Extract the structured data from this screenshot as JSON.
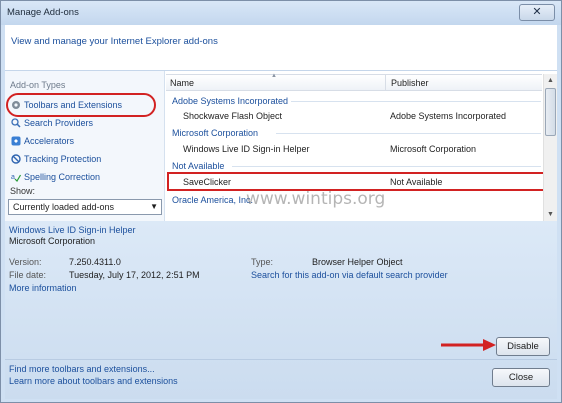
{
  "window": {
    "title": "Manage Add-ons",
    "close_glyph": "✕"
  },
  "header": {
    "text": "View and manage your Internet Explorer add-ons"
  },
  "left_pane": {
    "label": "Add-on Types",
    "items": [
      {
        "label": "Toolbars and Extensions",
        "icon": "gear-icon",
        "selected": true
      },
      {
        "label": "Search Providers",
        "icon": "search-icon",
        "selected": false
      },
      {
        "label": "Accelerators",
        "icon": "accelerator-icon",
        "selected": false
      },
      {
        "label": "Tracking Protection",
        "icon": "block-icon",
        "selected": false
      },
      {
        "label": "Spelling Correction",
        "icon": "spell-check-icon",
        "selected": false
      }
    ],
    "show_label": "Show:",
    "show_value": "Currently loaded add-ons"
  },
  "list": {
    "columns": {
      "name": "Name",
      "publisher": "Publisher"
    },
    "groups": [
      {
        "name": "Adobe Systems Incorporated",
        "rows": [
          {
            "name": "Shockwave Flash Object",
            "publisher": "Adobe Systems Incorporated"
          }
        ]
      },
      {
        "name": "Microsoft Corporation",
        "rows": [
          {
            "name": "Windows Live ID Sign-in Helper",
            "publisher": "Microsoft Corporation"
          }
        ]
      },
      {
        "name": "Not Available",
        "rows": [
          {
            "name": "SaveClicker",
            "publisher": "Not Available"
          }
        ]
      },
      {
        "name": "Oracle America, Inc.",
        "rows": []
      }
    ]
  },
  "watermark": "www.wintips.org",
  "details": {
    "title": "Windows Live ID Sign-in Helper",
    "company": "Microsoft Corporation",
    "version_label": "Version:",
    "version_value": "7.250.4311.0",
    "filedate_label": "File date:",
    "filedate_value": "Tuesday, July 17, 2012, 2:51 PM",
    "more_info": "More information",
    "type_label": "Type:",
    "type_value": "Browser Helper Object",
    "search_link": "Search for this add-on via default search provider",
    "disable_button": "Disable",
    "find_more": "Find more toolbars and extensions...",
    "learn_more": "Learn more about toolbars and extensions",
    "close_button": "Close"
  },
  "colors": {
    "link": "#1b4f9c",
    "highlight_red": "#d22222"
  }
}
